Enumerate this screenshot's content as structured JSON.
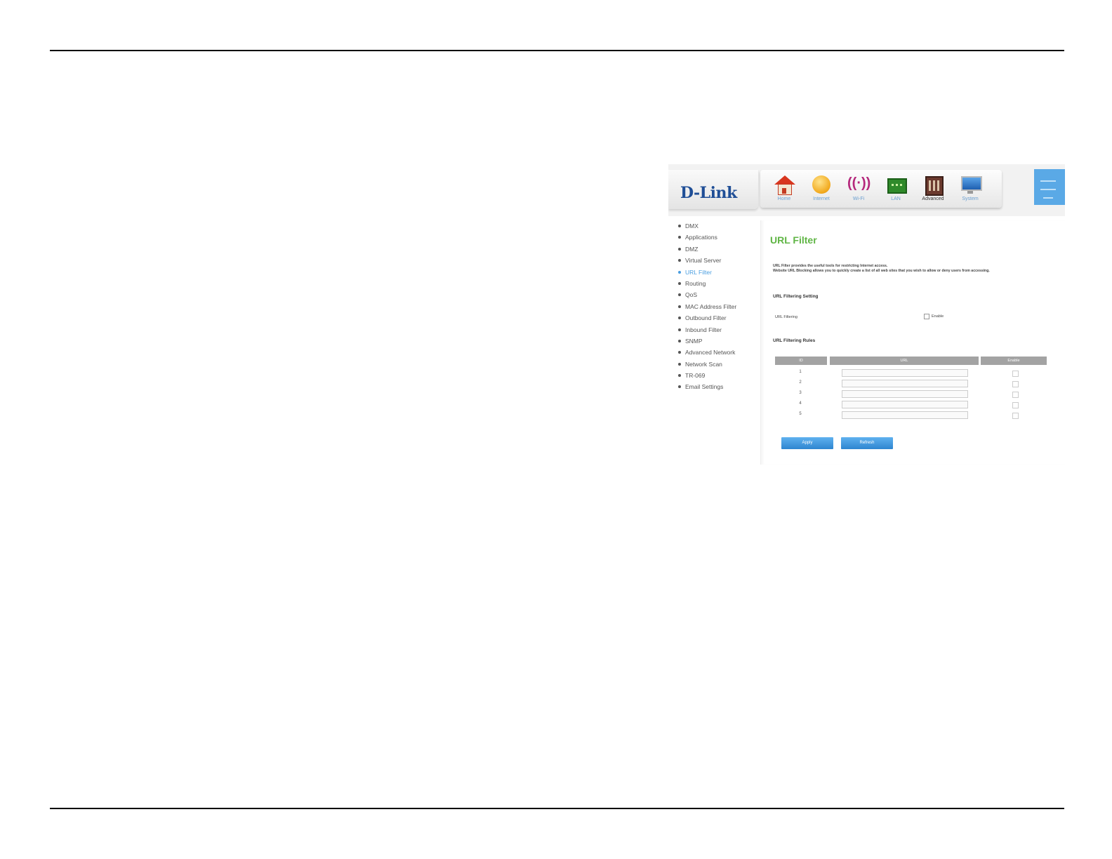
{
  "brand": {
    "logo": "D-Link"
  },
  "nav": [
    {
      "id": "home",
      "label": "Home",
      "icon": "home-icon"
    },
    {
      "id": "internet",
      "label": "Internet",
      "icon": "globe-icon"
    },
    {
      "id": "wifi",
      "label": "Wi-Fi",
      "icon": "wifi-icon"
    },
    {
      "id": "lan",
      "label": "LAN",
      "icon": "lan-icon"
    },
    {
      "id": "advanced",
      "label": "Advanced",
      "icon": "advanced-icon",
      "active": true
    },
    {
      "id": "system",
      "label": "System",
      "icon": "system-icon"
    }
  ],
  "sidebar": {
    "items": [
      {
        "label": "DMX"
      },
      {
        "label": "Applications"
      },
      {
        "label": "DMZ"
      },
      {
        "label": "Virtual Server"
      },
      {
        "label": "URL Filter",
        "active": true
      },
      {
        "label": "Routing"
      },
      {
        "label": "QoS"
      },
      {
        "label": "MAC Address Filter"
      },
      {
        "label": "Outbound Filter"
      },
      {
        "label": "Inbound Filter"
      },
      {
        "label": "SNMP"
      },
      {
        "label": "Advanced Network"
      },
      {
        "label": "Network Scan"
      },
      {
        "label": "TR-069"
      },
      {
        "label": "Email Settings"
      }
    ]
  },
  "main": {
    "title": "URL Filter",
    "description_line1": "URL Filter provides the useful tools for restricting Internet access.",
    "description_line2": "Website URL Blocking allows you to quickly create a list of all web sites that you wish to allow or deny users from accessing.",
    "section_setting": "URL Filtering Setting",
    "filtering_label": "URL Filtering",
    "enable_label": "Enable",
    "section_rules": "URL Filtering Rules",
    "columns": {
      "id": "ID",
      "url": "URL",
      "enable": "Enable"
    },
    "rows": [
      "1",
      "2",
      "3",
      "4",
      "5"
    ],
    "apply_button": "Apply",
    "refresh_button": "Refresh"
  }
}
